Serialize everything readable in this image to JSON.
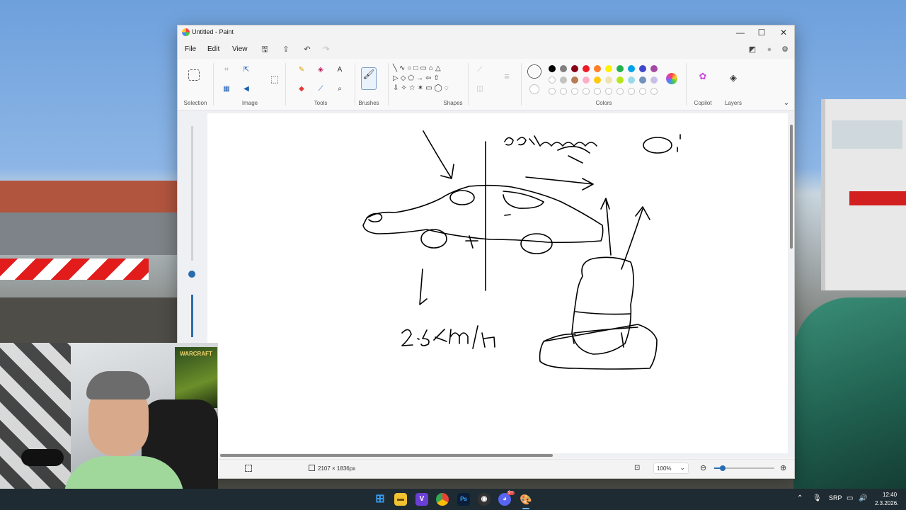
{
  "window": {
    "title": "Untitled - Paint",
    "controls": {
      "minimize": "—",
      "maximize": "☐",
      "close": "✕"
    }
  },
  "menu": {
    "file": "File",
    "edit": "Edit",
    "view": "View"
  },
  "ribbon": {
    "groups": {
      "selection": "Selection",
      "image": "Image",
      "tools": "Tools",
      "brushes": "Brushes",
      "shapes": "Shapes",
      "colors": "Colors",
      "copilot": "Copilot",
      "layers": "Layers"
    },
    "tools": {
      "text_glyph": "A"
    },
    "colors": {
      "primary": "#000000",
      "secondary": "#ffffff",
      "row1": [
        "#000000",
        "#7f7f7f",
        "#880015",
        "#ed1c24",
        "#ff7f27",
        "#fff200",
        "#22b14c",
        "#00a2e8",
        "#3f48cc",
        "#a349a4"
      ],
      "row2": [
        "#ffffff",
        "#c3c3c3",
        "#b97a57",
        "#ffaec9",
        "#ffc90e",
        "#efe4b0",
        "#b5e61d",
        "#99d9ea",
        "#7092be",
        "#c8bfe7"
      ]
    }
  },
  "status": {
    "canvas_size": "2107 × 1836px",
    "zoom": "100%"
  },
  "taskbar": {
    "apps": [
      "start",
      "file-explorer",
      "visual-studio",
      "chrome",
      "photoshop",
      "obs",
      "discord",
      "paint"
    ],
    "ps_label": "Ps",
    "vs_label": "V",
    "discord_badge": "9+",
    "tray": {
      "lang": "SRP",
      "time": "12:40",
      "date": "2.3.2026."
    }
  },
  "webcam": {
    "poster_text": "WARCRAFT"
  }
}
